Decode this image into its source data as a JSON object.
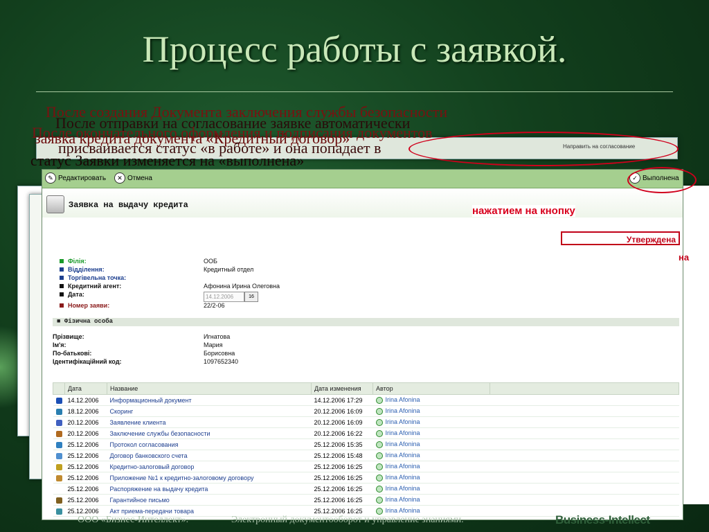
{
  "slide": {
    "title": "Процесс работы с заявкой.",
    "footer_left": "ООО «Бизнес-Интеллект».",
    "footer_mid": "Электронный документооборот и управление знаниями.",
    "footer_logo": "Business-Intellect"
  },
  "overlays": [
    "После создания Документа заключения службы безопасности",
    "После отправки на согласование заявке автоматически",
    "заявка кредита документа «Кредитный договор»",
    "После окончательного оформления и подписания документов",
    "присваивается статус «в работе» и она попадает в",
    "статус Заявки изменяется на «выполнена»"
  ],
  "hint": "нажатием на кнопку",
  "approved_label": "Утверждена",
  "approved_tail": "на",
  "toolbar": {
    "edit": "Редактировать",
    "cancel": "Отмена",
    "done": "Выполнена"
  },
  "back_toolbar": {
    "approve": "Направить на согласование"
  },
  "form": {
    "title": "Заявка на выдачу кредита",
    "fields": [
      {
        "label": "Філія:",
        "value": "ООБ",
        "color": "#1a9a2a"
      },
      {
        "label": "Відділення:",
        "value": "Кредитный отдел",
        "color": "#1d3f8f"
      },
      {
        "label": "Торгівельна точка:",
        "value": "",
        "color": "#1d3f8f"
      },
      {
        "label": "Кредитний агент:",
        "value": "Афонина Ирина Олеговна",
        "color": "#111"
      },
      {
        "label": "Дата:",
        "value": "",
        "color": "#111"
      },
      {
        "label": "Номер заяви:",
        "value": "22/2-06",
        "color": "#8a1a1a"
      }
    ],
    "date_value": "14.12.2006",
    "date_btn": "16",
    "section": "Фізична особа",
    "person": [
      {
        "label": "Прізвище:",
        "value": "Игнатова"
      },
      {
        "label": "Ім'я:",
        "value": "Мария"
      },
      {
        "label": "По-батькові:",
        "value": "Борисовна"
      },
      {
        "label": "Ідентифікаційний код:",
        "value": "1097652340"
      }
    ]
  },
  "table": {
    "headers": [
      "Дата",
      "Название",
      "Дата изменения",
      "Автор"
    ],
    "rows": [
      {
        "date": "14.12.2006",
        "name": "Информационный документ",
        "changed": "14.12.2006 17:29",
        "author": "Irina Afonina",
        "icon": "#1b4fb5"
      },
      {
        "date": "18.12.2006",
        "name": "Скоринг",
        "changed": "20.12.2006 16:09",
        "author": "Irina Afonina",
        "icon": "#2a7fb0"
      },
      {
        "date": "20.12.2006",
        "name": "Заявление клиента",
        "changed": "20.12.2006 16:09",
        "author": "Irina Afonina",
        "icon": "#4060c0"
      },
      {
        "date": "20.12.2006",
        "name": "Заключение службы безопасности",
        "changed": "20.12.2006 16:22",
        "author": "Irina Afonina",
        "icon": "#b06a20"
      },
      {
        "date": "25.12.2006",
        "name": "Протокол согласования",
        "changed": "25.12.2006 15:35",
        "author": "Irina Afonina",
        "icon": "#3080c0"
      },
      {
        "date": "25.12.2006",
        "name": "Договор банковского счета",
        "changed": "25.12.2006 15:48",
        "author": "Irina Afonina",
        "icon": "#5090d0"
      },
      {
        "date": "25.12.2006",
        "name": "Кредитно-залоговый договор",
        "changed": "25.12.2006 16:25",
        "author": "Irina Afonina",
        "icon": "#c0a020"
      },
      {
        "date": "25.12.2006",
        "name": "Приложение №1 к кредитно-залоговому договору",
        "changed": "25.12.2006 16:25",
        "author": "Irina Afonina",
        "icon": "#c08a30"
      },
      {
        "date": "25.12.2006",
        "name": "Распоряжение на выдачу кредита",
        "changed": "25.12.2006 16:25",
        "author": "Irina Afonina",
        "icon": "#ffffff"
      },
      {
        "date": "25.12.2006",
        "name": "Гарантийное письмо",
        "changed": "25.12.2006 16:25",
        "author": "Irina Afonina",
        "icon": "#806020"
      },
      {
        "date": "25.12.2006",
        "name": "Акт приема-передачи товара",
        "changed": "25.12.2006 16:25",
        "author": "Irina Afonina",
        "icon": "#3a90a0"
      }
    ]
  }
}
